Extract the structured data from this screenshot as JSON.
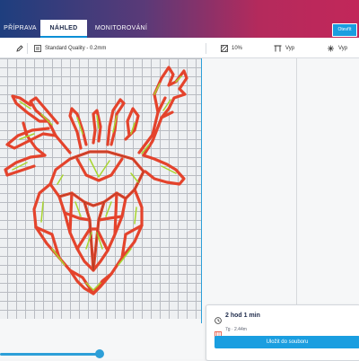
{
  "tabs": [
    {
      "label": "PŘÍPRAVA",
      "active": false
    },
    {
      "label": "NÁHLED",
      "active": true
    },
    {
      "label": "MONITOROVÁNÍ",
      "active": false
    }
  ],
  "header": {
    "right_button_label": "Otevřít"
  },
  "settings": {
    "profile": "Standard Quality - 0.2mm",
    "infill": "10%",
    "support": "Vyp",
    "adhesion": "Vyp"
  },
  "job": {
    "time": "2 hod 1 min",
    "usage": "7g · 2.44m",
    "save_label": "Uložit do souboru"
  },
  "colors": {
    "accent": "#1a9ee0",
    "wall_outer": "#e4432c",
    "wall_inner": "#a8d62e"
  },
  "icons": {
    "edit": "pencil-icon",
    "profile": "profile-icon",
    "infill": "infill-icon",
    "support": "support-icon",
    "adhesion": "adhesion-icon",
    "clock": "clock-icon",
    "filament": "filament-icon"
  }
}
